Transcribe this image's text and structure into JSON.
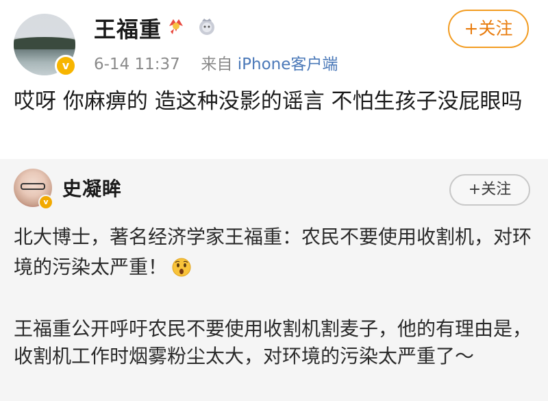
{
  "post": {
    "username": "王福重",
    "timestamp": "6-14 11:37",
    "source_prefix": "来自",
    "source_app": "iPhone客户端",
    "follow_label": "+关注",
    "text": "哎呀 你麻痹的 造这种没影的谣言  不怕生孩子没屁眼吗",
    "icons": {
      "verified": "verified-badge-icon",
      "medal": "medal-icon",
      "rank": "rank-icon"
    }
  },
  "quote": {
    "username": "史凝眸",
    "follow_label": "+关注",
    "paragraph1": "北大博士，著名经济学家王福重：农民不要使用收割机，对环境的污染太严重！",
    "paragraph2": "王福重公开呼吁农民不要使用收割机割麦子，他的有理由是，收割机工作时烟雾粉尘太大，对环境的污染太严重了～",
    "icons": {
      "verified": "verified-badge-icon",
      "emoji": "shocked-face-icon"
    }
  },
  "colors": {
    "accent_orange": "#e87b0c",
    "link_blue": "#4a78b8",
    "verified_gold": "#f7b500",
    "quote_bg": "#f5f5f5"
  }
}
